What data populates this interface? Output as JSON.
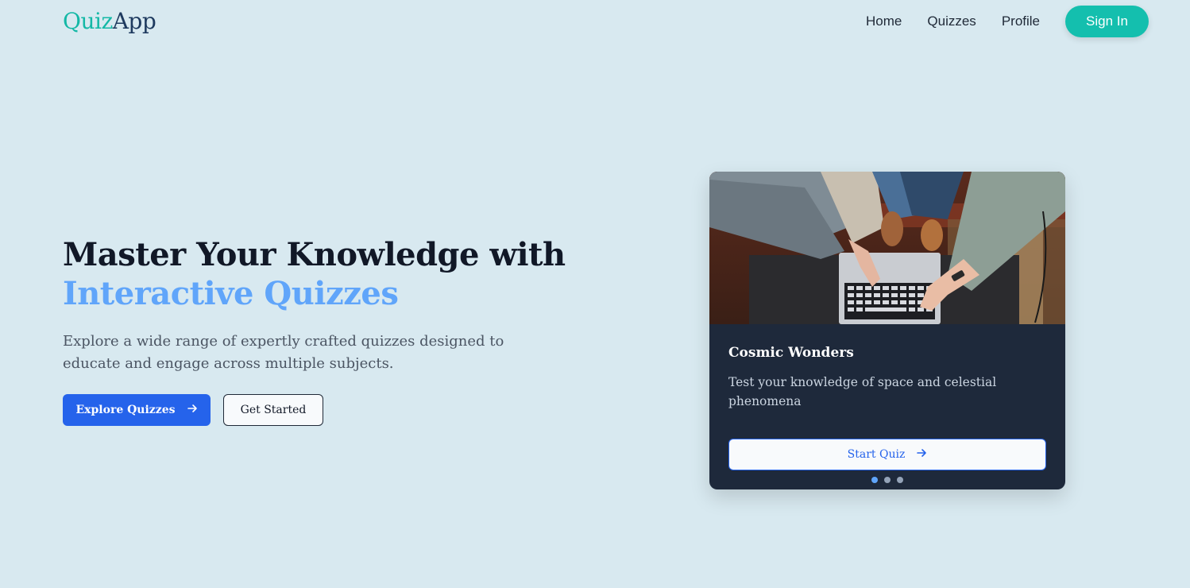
{
  "header": {
    "logo_part1": "Quiz",
    "logo_part2": "App",
    "nav": [
      {
        "label": "Home"
      },
      {
        "label": "Quizzes"
      },
      {
        "label": "Profile"
      }
    ],
    "signin_label": "Sign In"
  },
  "hero": {
    "title_line1": "Master Your Knowledge with",
    "title_line2": "Interactive Quizzes",
    "description": "Explore a wide range of expertly crafted quizzes designed to educate and engage across multiple subjects.",
    "primary_button": "Explore Quizzes",
    "secondary_button": "Get Started"
  },
  "card": {
    "title": "Cosmic Wonders",
    "description": "Test your knowledge of space and celestial phenomena",
    "button_label": "Start Quiz",
    "carousel_dots": 3,
    "active_dot": 1
  },
  "icons": {
    "arrow": "arrow-right-icon"
  },
  "colors": {
    "background": "#d8e9f0",
    "accent_teal": "#14bfae",
    "primary_blue": "#2563eb",
    "title_accent": "#60a5fa",
    "card_bg": "#1e293b"
  }
}
